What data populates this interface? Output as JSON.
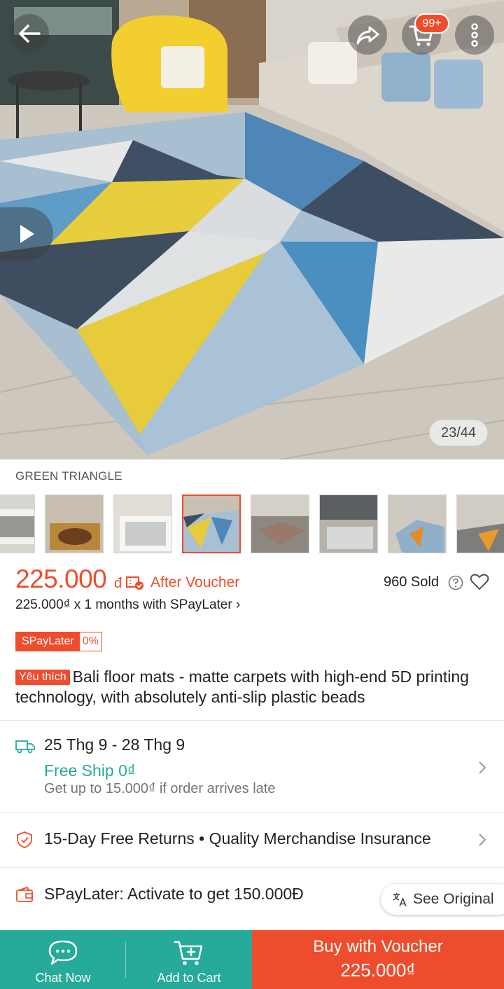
{
  "hero": {
    "image_counter": "23/44",
    "cart_badge": "99+"
  },
  "variant": {
    "name": "GREEN TRIANGLE",
    "thumbnails": [
      "gray-white rug",
      "beige ornate rug",
      "light gray rug",
      "geometric yellow-blue rug",
      "brown patterned rug",
      "gray living room rug",
      "orange-blue geometric rug",
      "orange-gray geometric rug"
    ],
    "selected_index": 3
  },
  "price": {
    "amount": "225.000",
    "currency": "đ",
    "after_voucher": "After Voucher",
    "sold": "960 Sold",
    "spaylater_line": "225.000₫ x 1 months with SPayLater ›",
    "badge_left": "SPayLater",
    "badge_right": "0%"
  },
  "product": {
    "badge": "Yêu thích",
    "title": "Bali floor mats - matte carpets with high-end 5D printing technology, with absolutely anti-slip plastic beads"
  },
  "shipping": {
    "date": "25 Thg 9 - 28 Thg 9",
    "free_ship": "Free Ship 0₫",
    "late_note": "Get up to 15.000₫ if order arrives late"
  },
  "returns": {
    "text": "15-Day Free Returns  •  Quality Merchandise Insurance"
  },
  "spaylater_promo": {
    "text": "SPayLater: Activate to get 150.000Đ",
    "see_original": "See Original"
  },
  "bottom_bar": {
    "chat": "Chat Now",
    "add_to_cart": "Add to Cart",
    "buy_line1": "Buy with Voucher",
    "buy_line2": "225.000₫"
  },
  "colors": {
    "accent": "#ee4d2d",
    "teal": "#26aa99"
  }
}
